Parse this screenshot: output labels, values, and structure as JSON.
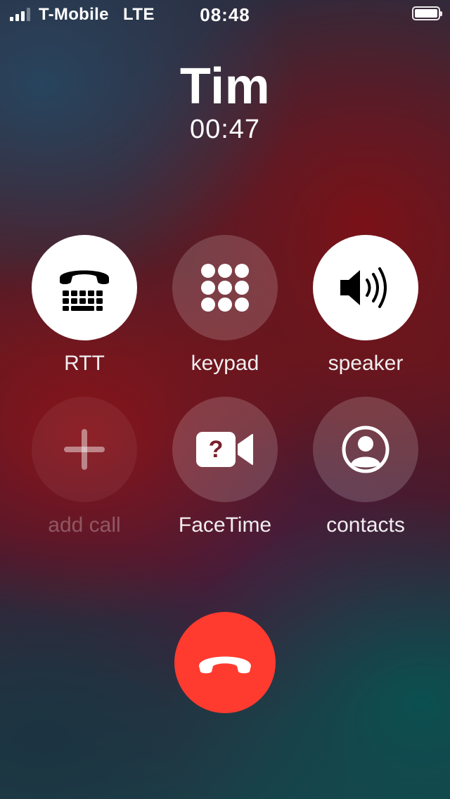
{
  "status_bar": {
    "carrier": "T-Mobile",
    "network": "LTE",
    "time": "08:48",
    "icons": [
      "signal-icon",
      "battery-icon"
    ]
  },
  "call": {
    "caller": "Tim",
    "duration": "00:47"
  },
  "controls": {
    "rtt": {
      "label": "RTT",
      "icon": "tty-icon"
    },
    "keypad": {
      "label": "keypad",
      "icon": "keypad-icon"
    },
    "speaker": {
      "label": "speaker",
      "icon": "speaker-icon"
    },
    "add_call": {
      "label": "add call",
      "icon": "plus-icon"
    },
    "facetime": {
      "label": "FaceTime",
      "icon": "facetime-icon"
    },
    "contacts": {
      "label": "contacts",
      "icon": "contact-icon"
    }
  },
  "end_call": {
    "icon": "hang-up-icon",
    "color": "#ff3b30"
  }
}
